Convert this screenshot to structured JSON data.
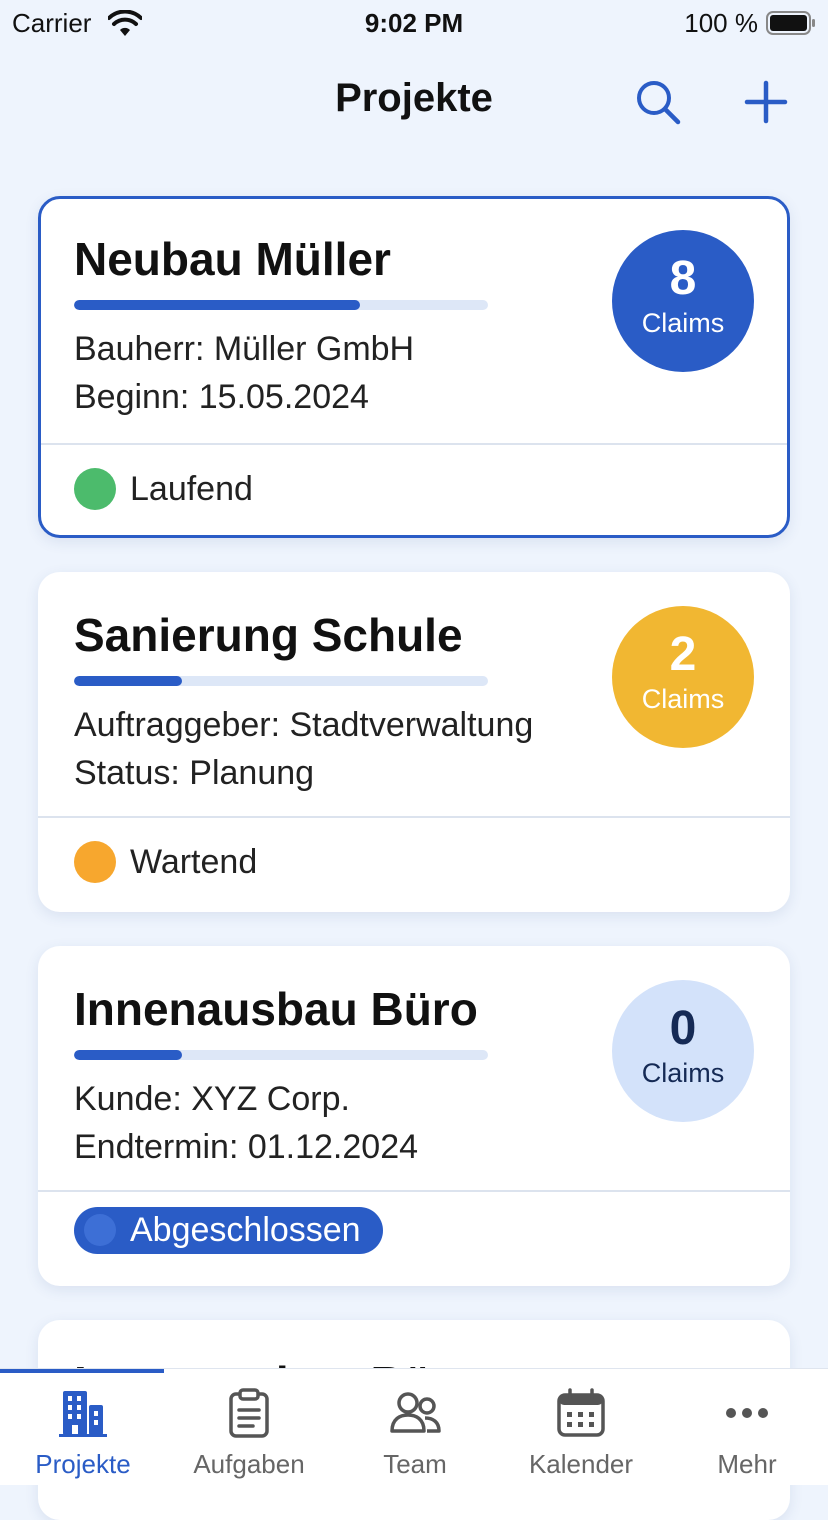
{
  "status_bar": {
    "carrier": "Carrier",
    "time": "9:02 PM",
    "battery": "100 %"
  },
  "header": {
    "title": "Projekte",
    "search_icon": "search-icon",
    "add_icon": "plus-icon",
    "accent": "#2a5cc6"
  },
  "projects": [
    {
      "title": "Neubau Müller",
      "progress": 0.69,
      "line1": "Bauherr: Müller GmbH",
      "line2": "Beginn: 15.05.2024",
      "claims_count": "8",
      "claims_label": "Claims",
      "badge_color": "#2a5cc6",
      "status": "Laufend",
      "status_color": "#4cbb6c"
    },
    {
      "title": "Sanierung Schule",
      "progress": 0.26,
      "line1": "Auftraggeber: Stadtverwaltung",
      "line2": "Status: Planung",
      "claims_count": "2",
      "claims_label": "Claims",
      "badge_color": "#f1b732",
      "status": "Wartend",
      "status_color": "#f7a72e"
    },
    {
      "title": "Innenausbau Büro",
      "progress": 0.26,
      "line1": "Kunde: XYZ Corp.",
      "line2": "Endtermin: 01.12.2024",
      "claims_count": "0",
      "claims_label": "Claims",
      "badge_color": "#d3e2fa",
      "status": "Abgeschlossen",
      "status_color": "#2a5cc6"
    },
    {
      "title": "Innenausbau Büro"
    }
  ],
  "tabs": [
    {
      "label": "Projekte",
      "icon": "building-icon",
      "active": true
    },
    {
      "label": "Aufgaben",
      "icon": "clipboard-icon",
      "active": false
    },
    {
      "label": "Team",
      "icon": "team-icon",
      "active": false
    },
    {
      "label": "Kalender",
      "icon": "calendar-icon",
      "active": false
    },
    {
      "label": "Mehr",
      "icon": "more-icon",
      "active": false
    }
  ]
}
